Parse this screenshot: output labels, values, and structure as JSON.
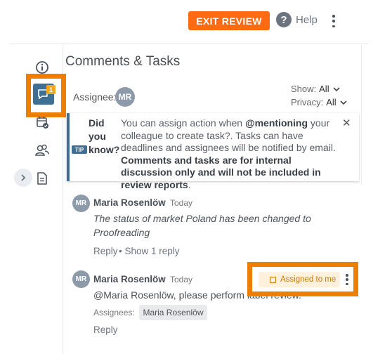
{
  "header": {
    "exit_review_label": "EXIT REVIEW",
    "help_label": "Help"
  },
  "panel": {
    "title": "Comments & Tasks",
    "assignee_label": "Assignee:",
    "assignee_initials": "MR",
    "show_label": "Show:",
    "show_value": "All",
    "privacy_label": "Privacy:",
    "privacy_value": "All"
  },
  "sidebar": {
    "comments_badge": "1",
    "icons": [
      "info-icon",
      "comments-icon",
      "calendar-check-icon",
      "users-icon",
      "document-icon",
      "chevron-right-icon"
    ]
  },
  "tip": {
    "line1": "Did",
    "line2": "you",
    "line3": "know?",
    "pill": "TIP",
    "text_a": "You can assign action when ",
    "text_mention": "@mentioning",
    "text_b": " your colleague to create task?. Tasks can have deadlines and assignees will be notified by email. ",
    "text_bold": "Comments and tasks are for internal discussion only and will not be included in review reports",
    "text_end": "."
  },
  "comments": [
    {
      "initials": "MR",
      "author": "Maria Rosenlöw",
      "dot": "•",
      "time": "Today",
      "body": "The status of market Poland has been changed to Proofreading",
      "reply_label": "Reply",
      "show_replies_label": "• Show 1 reply"
    },
    {
      "initials": "MR",
      "author": "Maria Rosenlöw",
      "dot": "•",
      "time": "Today",
      "body": "@Maria Rosenlöw, please perform label review.",
      "assignees_label": "Assignees:",
      "assignee_chip": "Maria Rosenlöw",
      "assigned_label": "Assigned to me",
      "reply_label": "Reply"
    }
  ],
  "colors": {
    "accent_orange": "#ff6a13",
    "highlight_orange": "#ef7d00",
    "brand_blue": "#3f6f93"
  }
}
